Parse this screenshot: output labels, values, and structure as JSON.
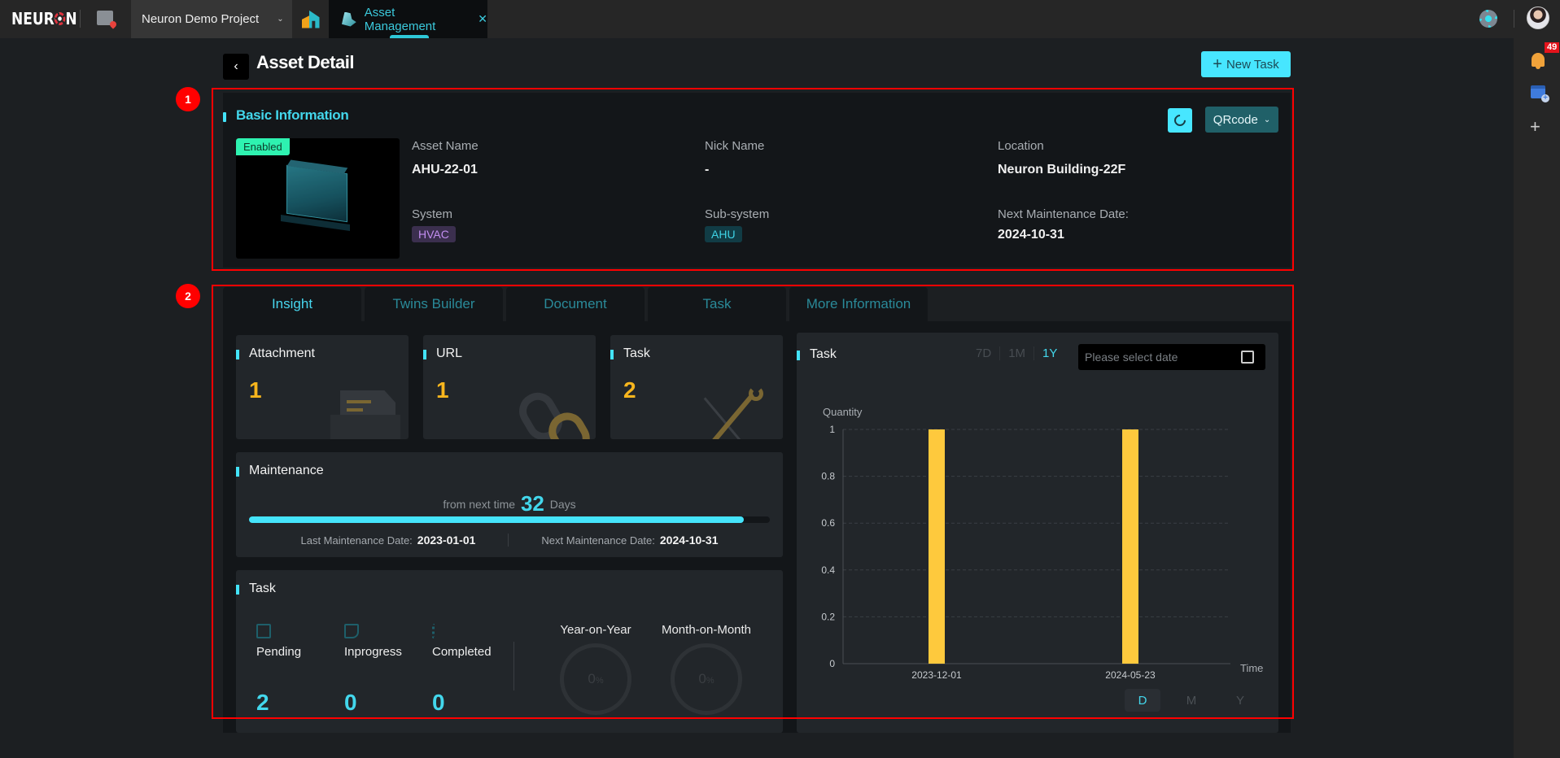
{
  "topbar": {
    "logo": "NEUR",
    "logo_tail": "N",
    "project": "Neuron Demo Project",
    "tab_label": "Asset Management",
    "notification_count": "49",
    "icons": [
      "map-icon",
      "chevron-down-icon",
      "home-icon",
      "asset-icon",
      "close-icon",
      "gear-icon",
      "avatar"
    ]
  },
  "rail": {
    "icons": [
      "bell-icon",
      "calendar-add-icon",
      "plus-icon"
    ]
  },
  "header": {
    "back": "‹",
    "title": "Asset Detail",
    "new_task": "New Task"
  },
  "markers": [
    "1",
    "2"
  ],
  "basic": {
    "title": "Basic Information",
    "qrcode": "QRcode",
    "status": "Enabled",
    "fields": {
      "asset_name_label": "Asset Name",
      "asset_name": "AHU-22-01",
      "nick_name_label": "Nick Name",
      "nick_name": "-",
      "location_label": "Location",
      "location": "Neuron Building-22F",
      "system_label": "System",
      "system": "HVAC",
      "subsystem_label": "Sub-system",
      "subsystem": "AHU",
      "next_maint_label": "Next Maintenance Date:",
      "next_maint": "2024-10-31"
    }
  },
  "tabs": [
    "Insight",
    "Twins Builder",
    "Document",
    "Task",
    "More Information"
  ],
  "active_tab": "Insight",
  "insight": {
    "attachment": {
      "label": "Attachment",
      "value": "1"
    },
    "url": {
      "label": "URL",
      "value": "1"
    },
    "task": {
      "label": "Task",
      "value": "2"
    },
    "maintenance": {
      "title": "Maintenance",
      "prefix": "from next time",
      "days": "32",
      "suffix": "Days",
      "progress_fraction": 0.95,
      "last_label": "Last Maintenance Date:",
      "last_date": "2023-01-01",
      "next_label": "Next Maintenance Date:",
      "next_date": "2024-10-31"
    },
    "task_summary": {
      "title": "Task",
      "pending_label": "Pending",
      "pending": "2",
      "inprogress_label": "Inprogress",
      "inprogress": "0",
      "completed_label": "Completed",
      "completed": "0",
      "yoy_label": "Year-on-Year",
      "yoy": "0",
      "mom_label": "Month-on-Month",
      "mom": "0",
      "percent": "%"
    }
  },
  "task_chart": {
    "title": "Task",
    "ranges": [
      "7D",
      "1M",
      "1Y"
    ],
    "active_range": "1Y",
    "date_placeholder": "Please select date",
    "granularity": [
      "D",
      "M",
      "Y"
    ],
    "active_granularity": "D",
    "bar_color": "#fec93d"
  },
  "chart_data": {
    "type": "bar",
    "title": "Task",
    "xlabel": "Time",
    "ylabel": "Quantity",
    "categories": [
      "2023-12-01",
      "2024-05-23"
    ],
    "values": [
      1,
      1
    ],
    "ylim": [
      0,
      1
    ],
    "yticks": [
      "0",
      "0.2",
      "0.4",
      "0.6",
      "0.8",
      "1"
    ],
    "grid": true
  }
}
